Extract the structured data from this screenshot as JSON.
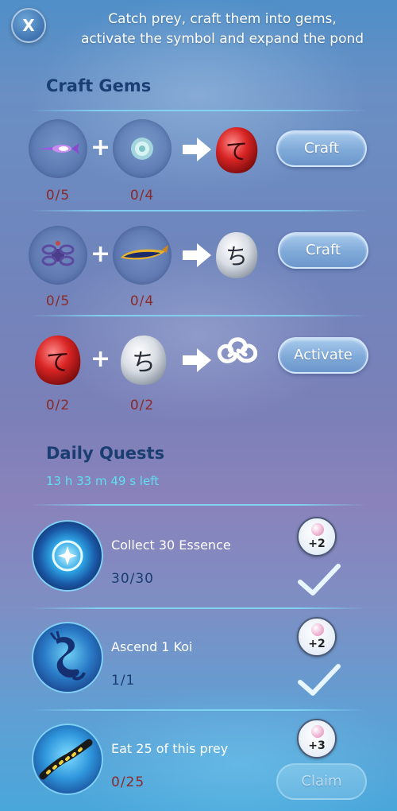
{
  "header": {
    "close_label": "X",
    "instructions_line1": "Catch prey, craft them into gems,",
    "instructions_line2": "activate the symbol and expand the pond"
  },
  "craft": {
    "title": "Craft Gems",
    "rows": [
      {
        "left_count": "0/5",
        "right_count": "0/4",
        "button": "Craft",
        "result_glyph": "て",
        "result_color": "#d93a3a"
      },
      {
        "left_count": "0/5",
        "right_count": "0/4",
        "button": "Craft",
        "result_glyph": "ち",
        "result_color": "#e9edf2"
      },
      {
        "left_count": "0/2",
        "right_count": "0/2",
        "button": "Activate",
        "left_glyph": "て",
        "right_glyph": "ち"
      }
    ],
    "plus": "+"
  },
  "quests": {
    "title": "Daily Quests",
    "timer": "13 h 33 m 49 s left",
    "items": [
      {
        "title": "Collect 30 Essence",
        "progress": "30/30",
        "reward": "+2",
        "completed": true,
        "icon": "essence-star-icon"
      },
      {
        "title": "Ascend 1 Koi",
        "progress": "1/1",
        "reward": "+2",
        "completed": true,
        "icon": "dragon-koi-icon"
      },
      {
        "title": "Eat 25 of this prey",
        "progress": "0/25",
        "reward": "+3",
        "completed": false,
        "claim": "Claim",
        "icon": "eel-prey-icon"
      }
    ]
  }
}
